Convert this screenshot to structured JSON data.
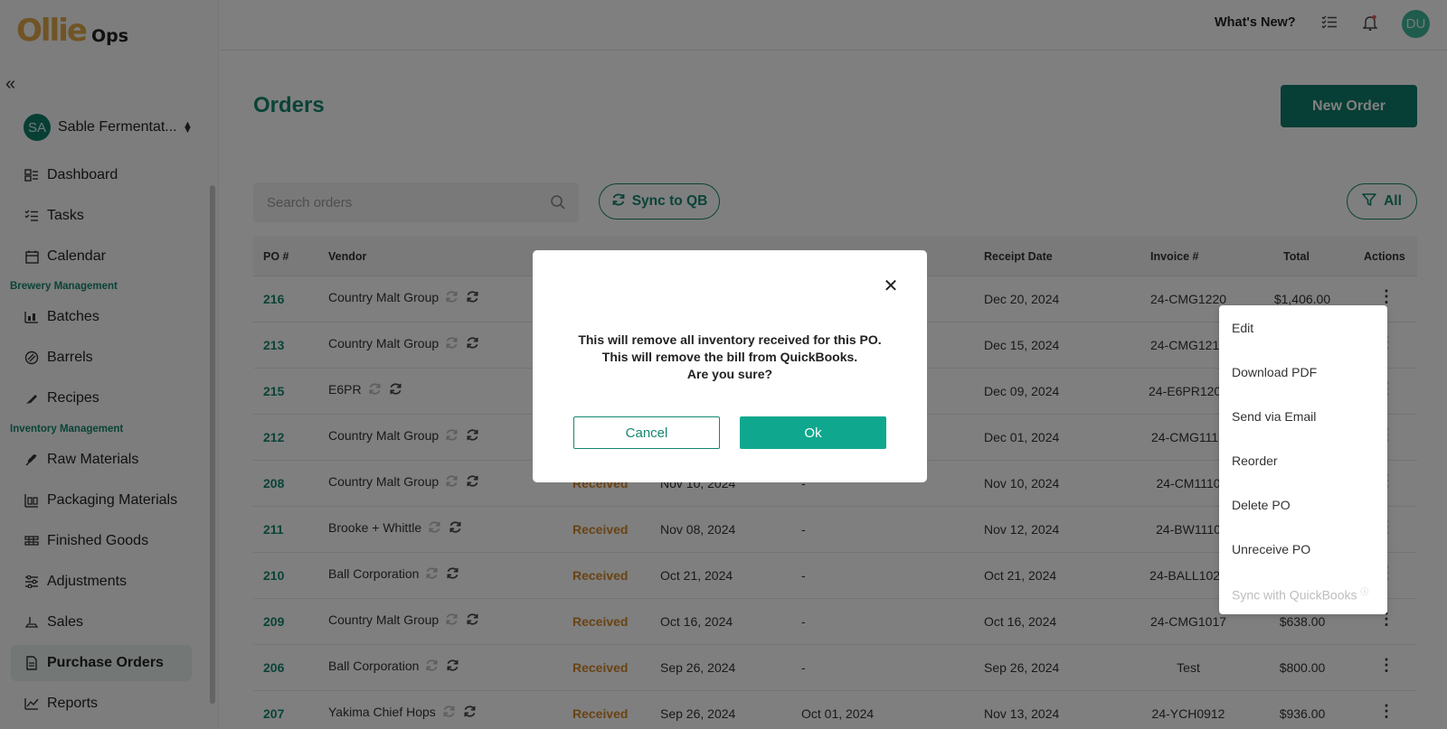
{
  "app": {
    "brand": "Ollie",
    "suffix": "Ops"
  },
  "org": {
    "initials": "SA",
    "name": "Sable Fermentat..."
  },
  "nav": {
    "dashboard": "Dashboard",
    "tasks": "Tasks",
    "calendar": "Calendar",
    "brewery_section": "Brewery Management",
    "batches": "Batches",
    "barrels": "Barrels",
    "recipes": "Recipes",
    "inventory_section": "Inventory Management",
    "raw_materials": "Raw Materials",
    "packaging_materials": "Packaging Materials",
    "finished_goods": "Finished Goods",
    "adjustments": "Adjustments",
    "sales": "Sales",
    "purchase_orders": "Purchase Orders",
    "reports": "Reports"
  },
  "header": {
    "whats_new": "What's New?",
    "user_initials": "DU"
  },
  "page": {
    "title": "Orders",
    "new_order": "New Order",
    "search_placeholder": "Search orders",
    "sync_label": "Sync to QB",
    "filter_label": "All"
  },
  "table": {
    "columns": {
      "po": "PO #",
      "vendor": "Vendor",
      "receipt_date": "Receipt Date",
      "invoice": "Invoice #",
      "total": "Total",
      "actions": "Actions"
    },
    "rows": [
      {
        "po": "216",
        "vendor": "Country Malt Group",
        "status": "",
        "date": "",
        "due": "",
        "receipt": "Dec 20, 2024",
        "invoice": "24-CMG1220",
        "total": "$1,406.00"
      },
      {
        "po": "213",
        "vendor": "Country Malt Group",
        "status": "",
        "date": "",
        "due": "",
        "receipt": "Dec 15, 2024",
        "invoice": "24-CMG1210",
        "total": ""
      },
      {
        "po": "215",
        "vendor": "E6PR",
        "status": "",
        "date": "",
        "due": "",
        "receipt": "Dec 09, 2024",
        "invoice": "24-E6PR1202",
        "total": ""
      },
      {
        "po": "212",
        "vendor": "Country Malt Group",
        "status": "",
        "date": "",
        "due": "",
        "receipt": "Dec 01, 2024",
        "invoice": "24-CMG1115",
        "total": ""
      },
      {
        "po": "208",
        "vendor": "Country Malt Group",
        "status": "Received",
        "date": "Nov 10, 2024",
        "due": "-",
        "receipt": "Nov 10, 2024",
        "invoice": "24-CM1110",
        "total": ""
      },
      {
        "po": "211",
        "vendor": "Brooke + Whittle",
        "status": "Received",
        "date": "Nov 08, 2024",
        "due": "-",
        "receipt": "Nov 12, 2024",
        "invoice": "24-BW1110",
        "total": ""
      },
      {
        "po": "210",
        "vendor": "Ball Corporation",
        "status": "Received",
        "date": "Oct 21, 2024",
        "due": "-",
        "receipt": "Oct 21, 2024",
        "invoice": "24-BALL1021",
        "total": ""
      },
      {
        "po": "209",
        "vendor": "Country Malt Group",
        "status": "Received",
        "date": "Oct 16, 2024",
        "due": "-",
        "receipt": "Oct 16, 2024",
        "invoice": "24-CMG1017",
        "total": "$638.00"
      },
      {
        "po": "206",
        "vendor": "Ball Corporation",
        "status": "Received",
        "date": "Sep 26, 2024",
        "due": "-",
        "receipt": "Sep 26, 2024",
        "invoice": "Test",
        "total": "$800.00"
      },
      {
        "po": "207",
        "vendor": "Yakima Chief Hops",
        "status": "Received",
        "date": "Sep 26, 2024",
        "due": "Oct 01, 2024",
        "receipt": "Nov 13, 2024",
        "invoice": "24-YCH0912",
        "total": "$936.00"
      }
    ]
  },
  "actions_menu": {
    "edit": "Edit",
    "download_pdf": "Download PDF",
    "send_email": "Send via Email",
    "reorder": "Reorder",
    "delete_po": "Delete PO",
    "unreceive_po": "Unreceive PO",
    "sync_qb": "Sync with QuickBooks"
  },
  "modal": {
    "line1": "This will remove all inventory received for this PO.",
    "line2": "This will remove the bill from QuickBooks.",
    "line3": "Are you sure?",
    "cancel": "Cancel",
    "ok": "Ok"
  },
  "colors": {
    "accent": "#15876f",
    "primary_button": "#0e7c6a",
    "ok_button": "#0fa88e",
    "received": "#d2872a",
    "logo": "#e0a94a"
  }
}
